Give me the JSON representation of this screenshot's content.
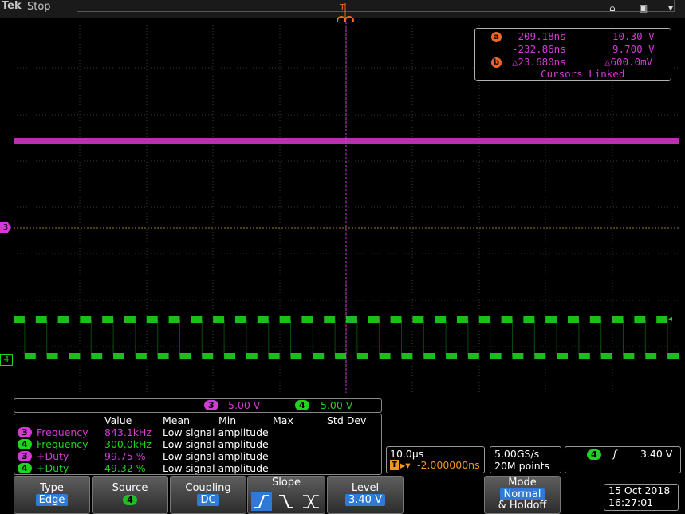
{
  "top": {
    "brand": "Tek",
    "status": "Stop"
  },
  "icons": [
    "trigger-t-icon",
    "home-icon",
    "window-icon",
    "menu-icon"
  ],
  "cursor_readout": {
    "a_time": "-209.18ns",
    "a_volt": "10.30 V",
    "b_time": "-232.86ns",
    "b_volt": "9.700 V",
    "delta_time": "△23.680ns",
    "delta_volt": "△600.0mV",
    "linked": "Cursors Linked",
    "a_label": "a",
    "b_label": "b"
  },
  "channels": {
    "ch3": {
      "num": "3",
      "scale": "5.00 V",
      "color": "#d63ad6"
    },
    "ch4": {
      "num": "4",
      "scale": "5.00 V",
      "color": "#1fd31f"
    }
  },
  "measurements": {
    "headers": [
      "Value",
      "Mean",
      "Min",
      "Max",
      "Std Dev"
    ],
    "rows": [
      {
        "ch": "3",
        "name": "Frequency",
        "value": "843.1kHz",
        "note": "Low signal amplitude"
      },
      {
        "ch": "4",
        "name": "Frequency",
        "value": "300.0kHz",
        "note": "Low signal amplitude"
      },
      {
        "ch": "3",
        "name": "+Duty",
        "value": "99.75 %",
        "note": "Low signal amplitude"
      },
      {
        "ch": "4",
        "name": "+Duty",
        "value": "49.32 %",
        "note": "Low signal amplitude"
      }
    ]
  },
  "timebase": {
    "scale": "10.0µs",
    "position": "-2.000000ns",
    "t_marker": "T"
  },
  "acquisition": {
    "rate": "5.00GS/s",
    "points": "20M points"
  },
  "trigger": {
    "ch": "4",
    "level": "3.40 V"
  },
  "menu": {
    "type_label": "Type",
    "type_value": "Edge",
    "source_label": "Source",
    "source_value": "4",
    "coupling_label": "Coupling",
    "coupling_value": "DC",
    "slope_label": "Slope",
    "level_label": "Level",
    "level_value": "3.40 V",
    "mode_label": "Mode",
    "mode_value": "Normal",
    "mode_extra": "& Holdoff"
  },
  "datetime": {
    "date": "15 Oct  2018",
    "time": "16:27:01"
  },
  "markers": {
    "ch3": "3",
    "ch4": "4"
  },
  "colors": {
    "ch3": "#d63ad6",
    "ch4": "#1fd31f",
    "cursor": "#f26522",
    "accent": "#2f7ad6"
  }
}
